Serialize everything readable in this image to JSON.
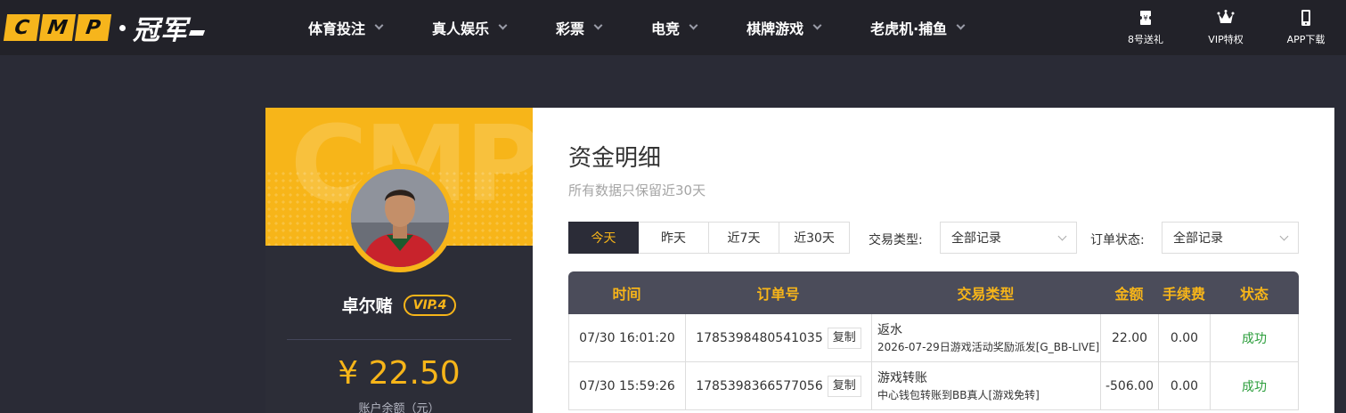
{
  "header": {
    "logo_letters": [
      "C",
      "M",
      "P"
    ],
    "logo_cn": "冠军",
    "nav": [
      {
        "label": "体育投注"
      },
      {
        "label": "真人娱乐"
      },
      {
        "label": "彩票"
      },
      {
        "label": "电竞"
      },
      {
        "label": "棋牌游戏"
      },
      {
        "label": "老虎机·捕鱼"
      }
    ],
    "quick_links": [
      {
        "label": "8号送礼",
        "icon": "ticket-icon"
      },
      {
        "label": "VIP特权",
        "icon": "crown-icon"
      },
      {
        "label": "APP下载",
        "icon": "phone-icon"
      }
    ]
  },
  "profile": {
    "banner_watermark": "CMP",
    "username": "卓尔赌",
    "vip_level": "VIP.4",
    "balance": "¥ 22.50",
    "balance_label": "账户余额（元）"
  },
  "main": {
    "title": "资金明细",
    "subtitle": "所有数据只保留近30天",
    "date_tabs": [
      "今天",
      "昨天",
      "近7天",
      "近30天"
    ],
    "active_tab": "今天",
    "filters": {
      "trade_type_label": "交易类型:",
      "trade_type_value": "全部记录",
      "order_status_label": "订单状态:",
      "order_status_value": "全部记录"
    },
    "table": {
      "columns": [
        "时间",
        "订单号",
        "交易类型",
        "金额",
        "手续费",
        "状态"
      ],
      "copy_label": "复制",
      "rows": [
        {
          "time": "07/30 16:01:20",
          "order_no": "1785398480541035",
          "type_main": "返水",
          "type_sub": "2026-07-29日游戏活动奖励派发[G_BB-LIVE]",
          "amount": "22.00",
          "fee": "0.00",
          "status": "成功"
        },
        {
          "time": "07/30 15:59:26",
          "order_no": "1785398366577056",
          "type_main": "游戏转账",
          "type_sub": "中心钱包转账到BB真人[游戏免转]",
          "amount": "-506.00",
          "fee": "0.00",
          "status": "成功"
        }
      ]
    }
  },
  "colors": {
    "accent": "#f7b519",
    "dark_bg": "#2a2b36",
    "header_bg": "#222229",
    "table_head_bg": "#4b4c5a",
    "success": "#2a9d3a"
  }
}
